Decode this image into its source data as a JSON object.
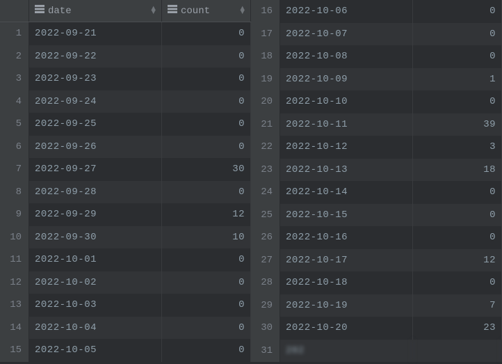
{
  "headers": {
    "date_label": "date",
    "count_label": "count"
  },
  "rows_left": [
    {
      "n": "1",
      "date": "2022-09-21",
      "count": "0"
    },
    {
      "n": "2",
      "date": "2022-09-22",
      "count": "0"
    },
    {
      "n": "3",
      "date": "2022-09-23",
      "count": "0"
    },
    {
      "n": "4",
      "date": "2022-09-24",
      "count": "0"
    },
    {
      "n": "5",
      "date": "2022-09-25",
      "count": "0"
    },
    {
      "n": "6",
      "date": "2022-09-26",
      "count": "0"
    },
    {
      "n": "7",
      "date": "2022-09-27",
      "count": "30"
    },
    {
      "n": "8",
      "date": "2022-09-28",
      "count": "0"
    },
    {
      "n": "9",
      "date": "2022-09-29",
      "count": "12"
    },
    {
      "n": "10",
      "date": "2022-09-30",
      "count": "10"
    },
    {
      "n": "11",
      "date": "2022-10-01",
      "count": "0"
    },
    {
      "n": "12",
      "date": "2022-10-02",
      "count": "0"
    },
    {
      "n": "13",
      "date": "2022-10-03",
      "count": "0"
    },
    {
      "n": "14",
      "date": "2022-10-04",
      "count": "0"
    },
    {
      "n": "15",
      "date": "2022-10-05",
      "count": "0"
    }
  ],
  "rows_right": [
    {
      "n": "16",
      "date": "2022-10-06",
      "count": "0"
    },
    {
      "n": "17",
      "date": "2022-10-07",
      "count": "0"
    },
    {
      "n": "18",
      "date": "2022-10-08",
      "count": "0"
    },
    {
      "n": "19",
      "date": "2022-10-09",
      "count": "1"
    },
    {
      "n": "20",
      "date": "2022-10-10",
      "count": "0"
    },
    {
      "n": "21",
      "date": "2022-10-11",
      "count": "39"
    },
    {
      "n": "22",
      "date": "2022-10-12",
      "count": "3"
    },
    {
      "n": "23",
      "date": "2022-10-13",
      "count": "18"
    },
    {
      "n": "24",
      "date": "2022-10-14",
      "count": "0"
    },
    {
      "n": "25",
      "date": "2022-10-15",
      "count": "0"
    },
    {
      "n": "26",
      "date": "2022-10-16",
      "count": "0"
    },
    {
      "n": "27",
      "date": "2022-10-17",
      "count": "12"
    },
    {
      "n": "28",
      "date": "2022-10-18",
      "count": "0"
    },
    {
      "n": "29",
      "date": "2022-10-19",
      "count": "7"
    },
    {
      "n": "30",
      "date": "2022-10-20",
      "count": "23"
    },
    {
      "n": "31",
      "date": "202",
      "count": "",
      "blurred": true
    }
  ]
}
